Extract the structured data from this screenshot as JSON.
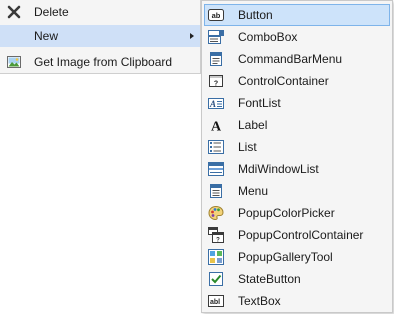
{
  "main_menu": {
    "items": [
      {
        "label": "Delete",
        "icon": "delete-x-icon"
      },
      {
        "label": "New",
        "icon": "none",
        "has_submenu": true,
        "selected": true
      },
      {
        "label": "Get Image from Clipboard",
        "icon": "picture-icon"
      }
    ]
  },
  "new_submenu": {
    "items": [
      {
        "label": "Button",
        "icon": "button-control-icon",
        "selected": true
      },
      {
        "label": "ComboBox",
        "icon": "combobox-icon"
      },
      {
        "label": "CommandBarMenu",
        "icon": "commandbar-menu-icon"
      },
      {
        "label": "ControlContainer",
        "icon": "control-container-icon"
      },
      {
        "label": "FontList",
        "icon": "fontlist-icon"
      },
      {
        "label": "Label",
        "icon": "label-icon"
      },
      {
        "label": "List",
        "icon": "list-icon"
      },
      {
        "label": "MdiWindowList",
        "icon": "mdi-window-list-icon"
      },
      {
        "label": "Menu",
        "icon": "menu-icon"
      },
      {
        "label": "PopupColorPicker",
        "icon": "color-palette-icon"
      },
      {
        "label": "PopupControlContainer",
        "icon": "popup-control-container-icon"
      },
      {
        "label": "PopupGalleryTool",
        "icon": "gallery-icon"
      },
      {
        "label": "StateButton",
        "icon": "checkbox-icon"
      },
      {
        "label": "TextBox",
        "icon": "textbox-icon"
      }
    ]
  },
  "colors": {
    "menu_background": "#f5f5f5",
    "selection_fill": "#cde3fa",
    "selection_border": "#7eb4ea",
    "text": "#1b1b1b"
  }
}
